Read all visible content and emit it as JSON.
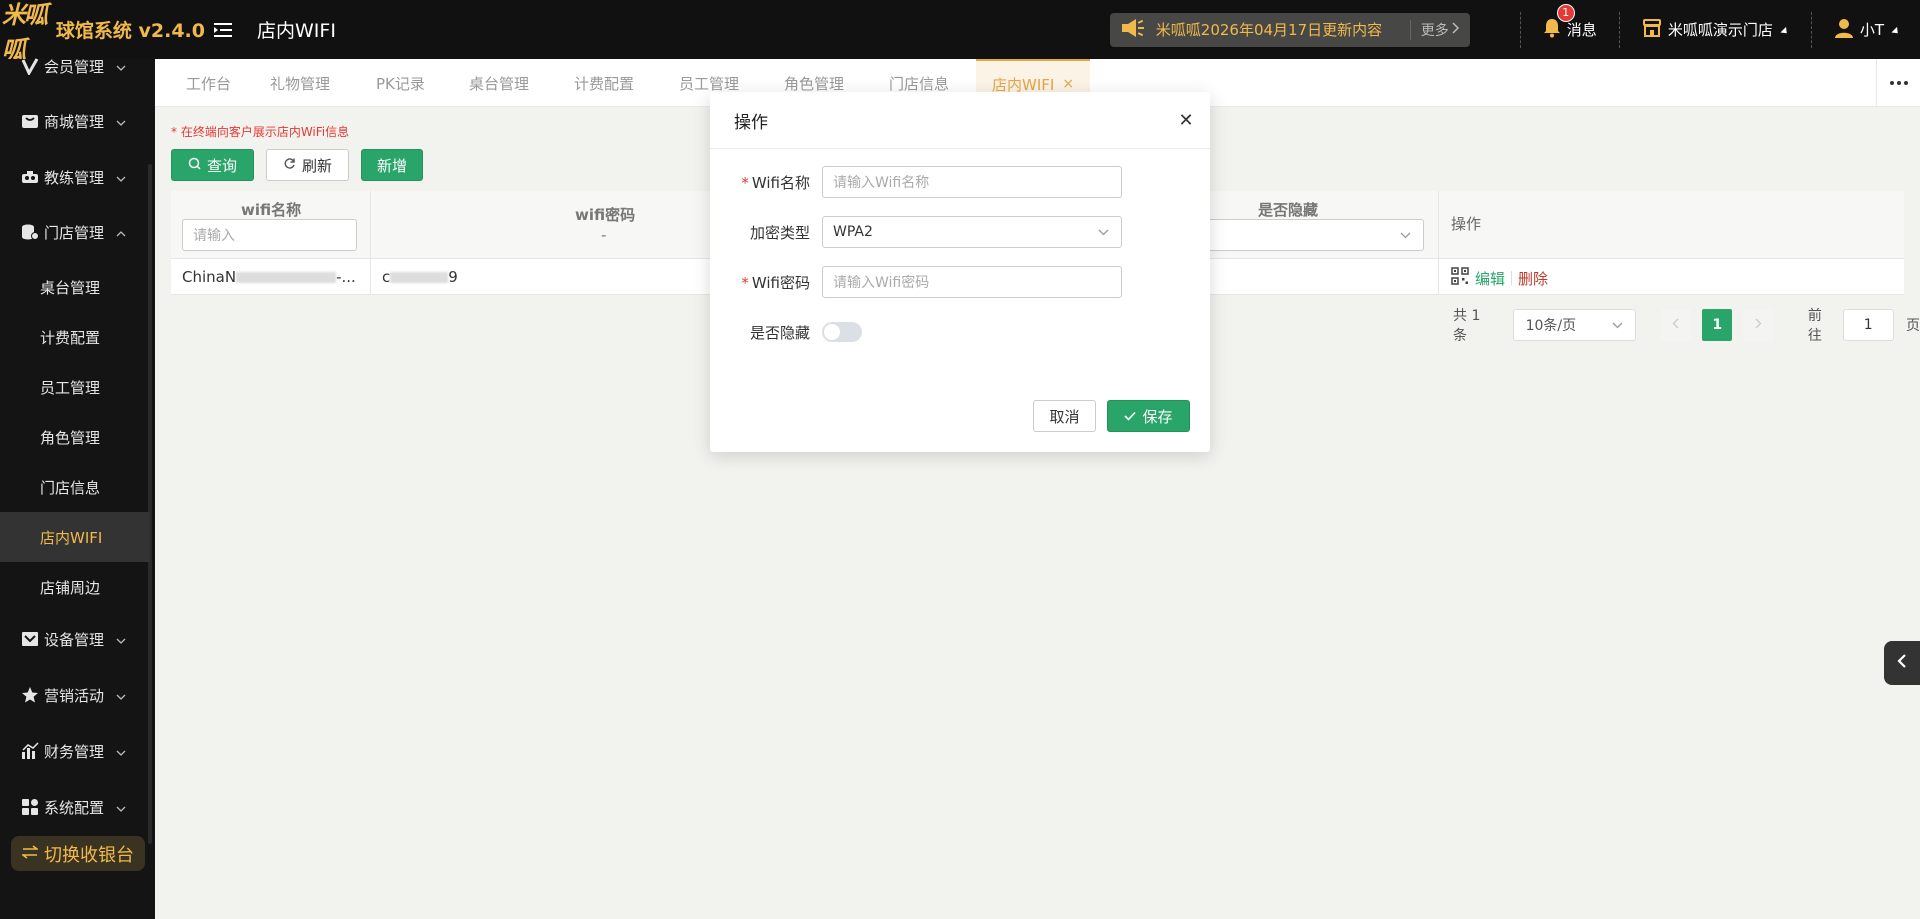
{
  "header": {
    "logo_mark": "米呱呱",
    "system_name": "球馆系统 v2.4.0",
    "page_title": "店内WIFI",
    "notice": "米呱呱2026年04月17日更新内容",
    "notice_more": "更多",
    "messages_label": "消息",
    "messages_count": "1",
    "store_name": "米呱呱演示门店",
    "user_name": "小T"
  },
  "sidebar": {
    "items": [
      {
        "label": "会员管理"
      },
      {
        "label": "商城管理"
      },
      {
        "label": "教练管理"
      },
      {
        "label": "门店管理"
      },
      {
        "label": "设备管理"
      },
      {
        "label": "营销活动"
      },
      {
        "label": "财务管理"
      },
      {
        "label": "系统配置"
      }
    ],
    "sub_items": [
      {
        "label": "桌台管理"
      },
      {
        "label": "计费配置"
      },
      {
        "label": "员工管理"
      },
      {
        "label": "角色管理"
      },
      {
        "label": "门店信息"
      },
      {
        "label": "店内WIFI"
      },
      {
        "label": "店铺周边"
      }
    ],
    "switch_label": "切换收银台"
  },
  "tabs": [
    {
      "label": "工作台"
    },
    {
      "label": "礼物管理"
    },
    {
      "label": "PK记录"
    },
    {
      "label": "桌台管理"
    },
    {
      "label": "计费配置"
    },
    {
      "label": "员工管理"
    },
    {
      "label": "角色管理"
    },
    {
      "label": "门店信息"
    },
    {
      "label": "店内WIFI"
    }
  ],
  "content": {
    "hint": "* 在终端向客户展示店内WiFi信息",
    "query_label": "查询",
    "refresh_label": "刷新",
    "add_label": "新增"
  },
  "table": {
    "columns": {
      "name": "wifi名称",
      "password": "wifi密码",
      "password_sub": "-",
      "hidden": "是否隐藏",
      "ops": "操作"
    },
    "filter_placeholder": "请输入",
    "rows": [
      {
        "name_prefix": "ChinaN",
        "name_suffix": "-...",
        "password_prefix": "c",
        "password_suffix": "9",
        "edit": "编辑",
        "delete": "删除"
      }
    ]
  },
  "pagination": {
    "total": "共 1 条",
    "page_size": "10条/页",
    "current": "1",
    "goto_label": "前往",
    "goto_value": "1",
    "page_unit": "页"
  },
  "modal": {
    "title": "操作",
    "fields": {
      "name_label": "Wifi名称",
      "name_placeholder": "请输入Wifi名称",
      "enc_label": "加密类型",
      "enc_value": "WPA2",
      "pwd_label": "Wifi密码",
      "pwd_placeholder": "请输入Wifi密码",
      "hidden_label": "是否隐藏"
    },
    "required_mark": "*",
    "cancel_label": "取消",
    "save_label": "保存"
  },
  "colors": {
    "accent": "#f1b94b",
    "primary": "#2aa56a",
    "danger": "#e53935"
  }
}
